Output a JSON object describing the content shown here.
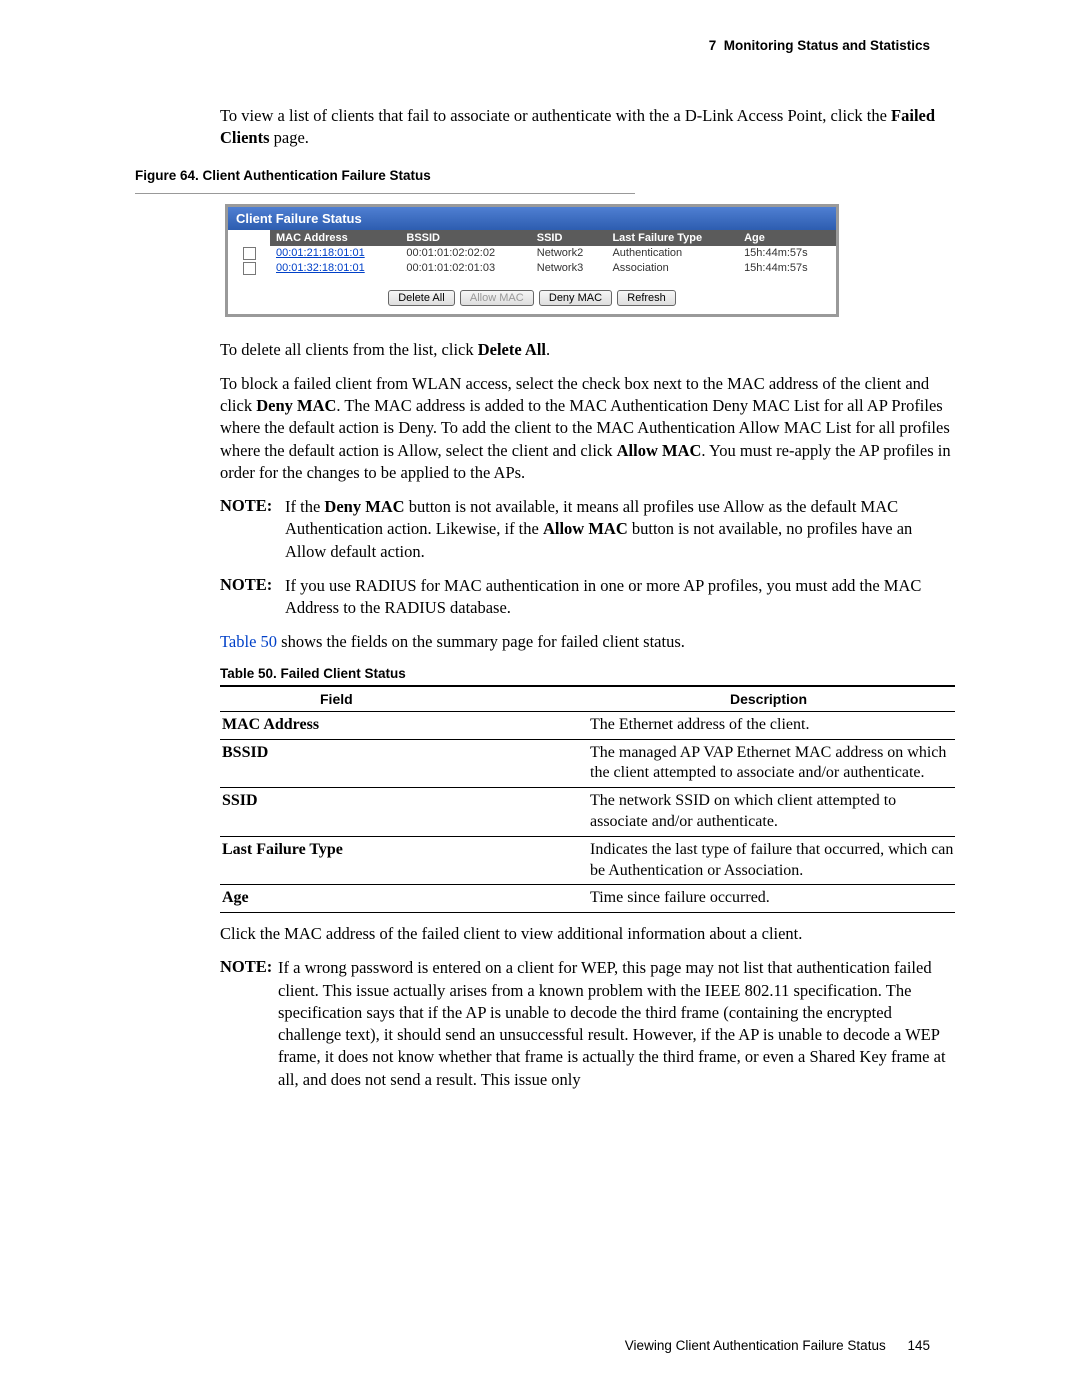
{
  "chapter_heading_num": "7",
  "chapter_heading_title": "Monitoring Status and Statistics",
  "intro_para_pre": "To view a list of clients that fail to associate or authenticate with the a D-Link Access Point, click the ",
  "intro_para_bold": "Failed Clients",
  "intro_para_post": " page.",
  "figure_caption": "Figure 64.  Client Authentication Failure Status",
  "panel": {
    "title": "Client Failure Status",
    "headers": [
      "MAC Address",
      "BSSID",
      "SSID",
      "Last Failure Type",
      "Age"
    ],
    "rows": [
      {
        "mac": "00:01:21:18:01:01",
        "bssid": "00:01:01:02:02:02",
        "ssid": "Network2",
        "fail": "Authentication",
        "age": "15h:44m:57s"
      },
      {
        "mac": "00:01:32:18:01:01",
        "bssid": "00:01:01:02:01:03",
        "ssid": "Network3",
        "fail": "Association",
        "age": "15h:44m:57s"
      }
    ],
    "buttons": {
      "delete_all": "Delete All",
      "allow_mac": "Allow MAC",
      "deny_mac": "Deny MAC",
      "refresh": "Refresh"
    }
  },
  "para_delete_pre": "To delete all clients from the list, click ",
  "para_delete_bold": "Delete All",
  "para_delete_post": ".",
  "para_block_1": "To block a failed client from WLAN access, select the check box next to the MAC address of the client and click ",
  "para_block_bold1": "Deny MAC",
  "para_block_2": ". The MAC address is added to the MAC Authentication Deny MAC List for all AP Profiles where the default action is Deny. To add the client to the MAC Authentication Allow MAC List for all profiles where the default action is Allow, select the client and click ",
  "para_block_bold2": "Allow MAC",
  "para_block_3": ". You must re-apply the AP profiles in order for the changes to be applied to the APs.",
  "note1_label": "NOTE:",
  "note1_pre": "If the ",
  "note1_bold1": "Deny MAC",
  "note1_mid": " button is not available, it means all profiles use Allow as the default MAC Authentication action. Likewise, if the ",
  "note1_bold2": "Allow MAC",
  "note1_post": " button is not available, no profiles have an Allow default action.",
  "note2_label": "NOTE:",
  "note2_body": "If you use RADIUS for MAC authentication in one or more AP profiles, you must add the MAC Address to the RADIUS database.",
  "para_tableref_link": "Table 50",
  "para_tableref_post": " shows the fields on the summary page for failed client status.",
  "table_caption_bold": "Table 50.",
  "table_caption_rest": " Failed Client Status",
  "fields_table": {
    "headers": {
      "field": "Field",
      "desc": "Description"
    },
    "rows": [
      {
        "field": "MAC Address",
        "desc": "The Ethernet address of the client."
      },
      {
        "field": "BSSID",
        "desc": "The managed AP VAP Ethernet MAC address on which the client attempted to associate and/or authenticate."
      },
      {
        "field": "SSID",
        "desc": "The network SSID on which client attempted to associate and/or authenticate."
      },
      {
        "field": "Last Failure Type",
        "desc": "Indicates the last type of failure that occurred, which can be Authentication or Association."
      },
      {
        "field": "Age",
        "desc": "Time since failure occurred."
      }
    ]
  },
  "para_click_mac": "Click the MAC address of the failed client to view additional information about a client.",
  "note3_label": "NOTE:",
  "note3_body": "If a wrong password is entered on a client for WEP, this page may not list that authentication failed client. This issue actually arises from a known problem with the IEEE 802.11 specification. The specification says that if the AP is unable to decode the third frame (containing the encrypted challenge text), it should send an unsuccessful result. However, if the AP is unable to decode a WEP frame, it does not know whether that frame is actually the third frame, or even a Shared Key frame at all, and does not send a result. This issue only",
  "footer_text": "Viewing Client Authentication Failure Status",
  "footer_page": "145"
}
